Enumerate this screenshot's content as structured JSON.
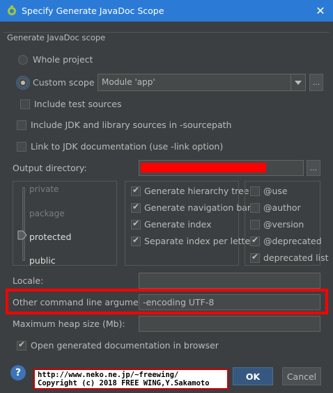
{
  "window": {
    "title": "Specify Generate JavaDoc Scope",
    "close_glyph": "✕",
    "icon": "android-icon"
  },
  "group": {
    "title": "Generate JavaDoc scope"
  },
  "scope": {
    "whole_project_label": "Whole project",
    "custom_scope_label": "Custom scope",
    "selected": "custom",
    "module_value": "Module 'app'",
    "more_glyph": "..."
  },
  "options": {
    "include_test_sources": {
      "label": "Include test sources",
      "checked": false
    },
    "include_jdk": {
      "label": "Include JDK and library sources in -sourcepath",
      "checked": false
    },
    "link_jdk": {
      "label": "Link to JDK documentation (use -link option)",
      "checked": false
    }
  },
  "output": {
    "label": "Output directory:",
    "value": "",
    "redacted": true,
    "browse_glyph": "..."
  },
  "visibility": {
    "levels": [
      "private",
      "package",
      "protected",
      "public"
    ],
    "selected": "protected"
  },
  "generate": {
    "items": [
      {
        "label": "Generate hierarchy tree",
        "checked": true
      },
      {
        "label": "Generate navigation bar",
        "checked": true
      },
      {
        "label": "Generate index",
        "checked": true
      },
      {
        "label": "Separate index per letter",
        "checked": true
      }
    ]
  },
  "tags": {
    "items": [
      {
        "label": "@use",
        "checked": false
      },
      {
        "label": "@author",
        "checked": false
      },
      {
        "label": "@version",
        "checked": false
      },
      {
        "label": "@deprecated",
        "checked": true
      },
      {
        "label": "deprecated list",
        "checked": true
      }
    ]
  },
  "locale": {
    "label": "Locale:",
    "value": ""
  },
  "other_args": {
    "label": "Other command line arguments:",
    "value": "-encoding UTF-8"
  },
  "heap": {
    "label": "Maximum heap size (Mb):",
    "value": ""
  },
  "open_in_browser": {
    "label": "Open generated documentation in browser",
    "checked": true
  },
  "footer": {
    "help_glyph": "?",
    "watermark_line1": "http://www.neko.ne.jp/~freewing/",
    "watermark_line2": "Copyright (c) 2018 FREE WING,Y.Sakamoto",
    "ok_label": "OK",
    "cancel_label": "Cancel"
  },
  "colors": {
    "titlebar": "#2b7bd6",
    "background": "#3c3f41",
    "highlight_border": "#ff0000",
    "redaction": "#ff0000"
  }
}
